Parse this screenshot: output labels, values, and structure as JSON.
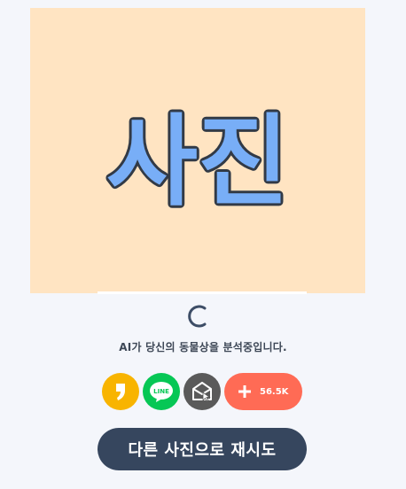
{
  "photo": {
    "placeholder_text": "사진",
    "background": "#ffe4c2",
    "text_fill": "#78aef7",
    "text_stroke": "#323a46"
  },
  "status": {
    "text": "AI가 당신의 동물상을 분석중입니다."
  },
  "share": {
    "kakao_icon": "kakao-icon",
    "line_icon": "line-icon",
    "line_label": "LINE",
    "mail_icon": "mail-icon",
    "plus_icon": "plus-icon",
    "count": "56.5K"
  },
  "actions": {
    "retry_label": "다른 사진으로 재시도"
  },
  "colors": {
    "page_bg": "#f4f6fb",
    "kakao": "#f8b400",
    "line": "#06c755",
    "mail": "#5a5a5a",
    "plus": "#ff6b55",
    "retry": "#36465e"
  }
}
